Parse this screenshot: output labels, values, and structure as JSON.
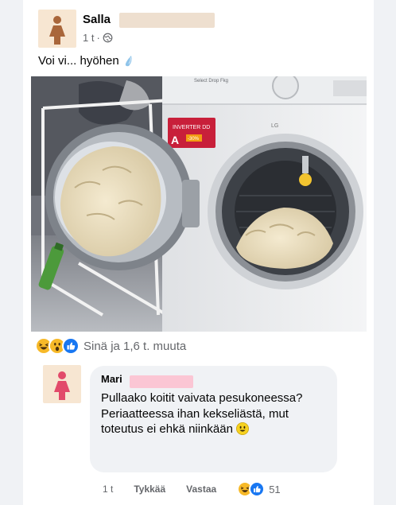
{
  "post": {
    "author": "Salla",
    "time": "1 t",
    "separator": "·",
    "text": "Voi vi... hyöhen"
  },
  "reactions": {
    "icons": [
      "haha-emoji-icon",
      "wow-emoji-icon",
      "like-thumb-icon"
    ],
    "summary": "Sinä ja 1,6 t. muuta"
  },
  "comment": {
    "author": "Mari",
    "text": "Pullaako koitit vaivata pesukoneessa? Periaatteessa ihan kekseliästä, mut toteutus ei ehkä niinkään",
    "actions": {
      "time": "1 t",
      "like": "Tykkää",
      "reply": "Vastaa",
      "reaction_count": "51"
    }
  },
  "photo": {
    "machine_brand": "LG",
    "panel_label": "Select Drop Fkg",
    "energy_class": "A",
    "energy_extra": "-30%",
    "direct_drive": "INVERTER DD"
  },
  "colors": {
    "avatar_bg_post": "#f7e6d2",
    "avatar_bg_comment": "#f7e6d2",
    "person_icon": "#a9663b",
    "person_icon_comment": "#e24a6a",
    "redact_post": "#eedfcf",
    "redact_comment": "#fbc6d4",
    "like_blue": "#1877f2"
  }
}
